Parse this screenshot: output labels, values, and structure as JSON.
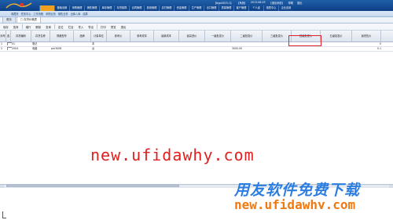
{
  "banner": {
    "user_info": [
      "【bjgs0015-1】",
      "【系统】",
      "2013-08-03",
      "【退出系统】"
    ],
    "links": [
      "帮助",
      "退出"
    ]
  },
  "menu": [
    "",
    "基础设置",
    "采购管理",
    "销售管理",
    "库存管理",
    "存货核算",
    "合同管理",
    "费用管理",
    "应付管理",
    "资金管理",
    "生产管理",
    "出口管理",
    "质量管理",
    "客户管理",
    "个人桌",
    "报表中心",
    "企业应用"
  ],
  "quickbar": [
    "收藏夹",
    "任务中心",
    "工作流程",
    "采购业务",
    "销售业务",
    "出库入库",
    "结算"
  ],
  "tabs": [
    {
      "label": "首页",
      "active": false
    },
    {
      "label": "□ 存货价格表",
      "active": true
    }
  ],
  "toolbar": [
    "保存",
    "放弃",
    "增行",
    "删除",
    "查询",
    "定位",
    "栏目",
    "导入",
    "导出",
    "打印",
    "预览",
    "退出"
  ],
  "grid": {
    "headers": [
      "序号",
      "选",
      "存货编码",
      "存货名称",
      "规格型号",
      "品牌",
      "计量单位",
      "参考价",
      "参考成本",
      "最新成本",
      "最高进价",
      "一级批发价",
      "二级批发价",
      "三级批发价",
      "四级批发价",
      "五级批发价",
      "最低售价"
    ],
    "rows": [
      {
        "no": "1",
        "code": "01",
        "name": "笔记",
        "spec": "",
        "unit": "本",
        "price1": "",
        "price2": "",
        "last": "0"
      },
      {
        "no": "2",
        "code": "2004",
        "name": "电脑",
        "spec": "pm3008",
        "unit": "台",
        "price1": "",
        "price2": "3000.00",
        "last": "0.1"
      }
    ]
  },
  "watermark": {
    "center_text": "new.ufidawhy.com",
    "cn_text": "用友软件免费下载",
    "url_text": "new.ufidawhy.com"
  }
}
